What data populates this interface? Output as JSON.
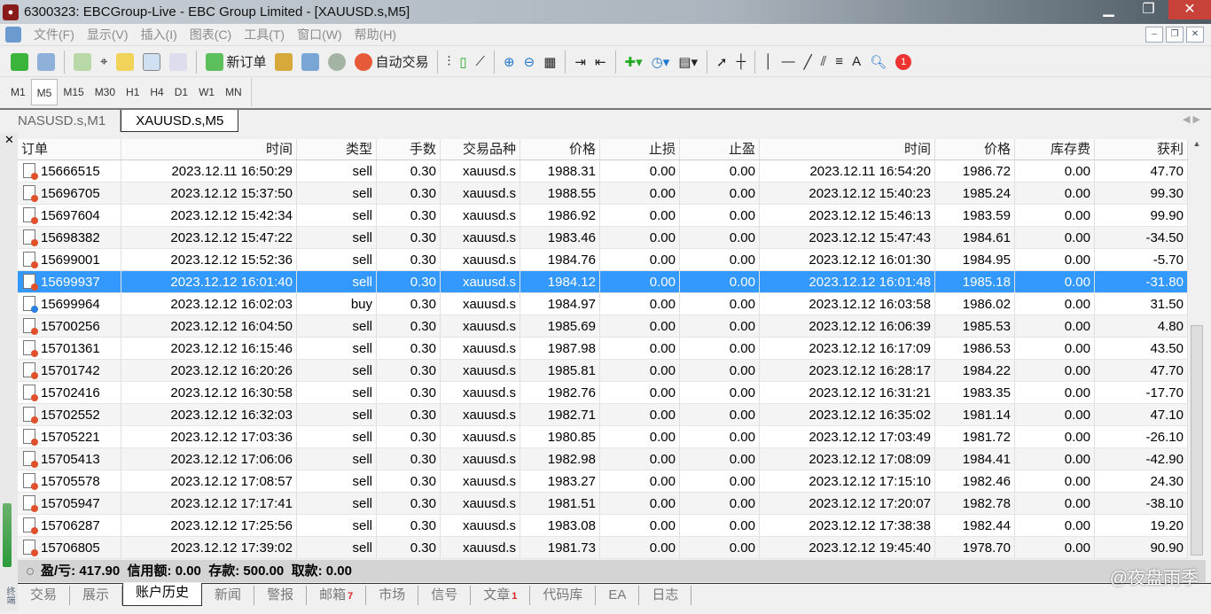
{
  "window": {
    "title": "6300323: EBCGroup-Live - EBC Group Limited - [XAUUSD.s,M5]"
  },
  "menu": [
    "文件(F)",
    "显示(V)",
    "插入(I)",
    "图表(C)",
    "工具(T)",
    "窗口(W)",
    "帮助(H)"
  ],
  "toolbar": {
    "new_order": "新订单",
    "auto_trading": "自动交易",
    "notification_count": "1"
  },
  "periods": [
    "M1",
    "M5",
    "M15",
    "M30",
    "H1",
    "H4",
    "D1",
    "W1",
    "MN"
  ],
  "selected_period": "M5",
  "chart_tabs": [
    "NASUSD.s,M1",
    "XAUUSD.s,M5"
  ],
  "table": {
    "columns": [
      "订单",
      "时间",
      "类型",
      "手数",
      "交易品种",
      "价格",
      "止损",
      "止盈",
      "时间",
      "价格",
      "库存费",
      "获利"
    ],
    "rows": [
      [
        "15666515",
        "2023.12.11 16:50:29",
        "sell",
        "0.30",
        "xauusd.s",
        "1988.31",
        "0.00",
        "0.00",
        "2023.12.11 16:54:20",
        "1986.72",
        "0.00",
        "47.70"
      ],
      [
        "15696705",
        "2023.12.12 15:37:50",
        "sell",
        "0.30",
        "xauusd.s",
        "1988.55",
        "0.00",
        "0.00",
        "2023.12.12 15:40:23",
        "1985.24",
        "0.00",
        "99.30"
      ],
      [
        "15697604",
        "2023.12.12 15:42:34",
        "sell",
        "0.30",
        "xauusd.s",
        "1986.92",
        "0.00",
        "0.00",
        "2023.12.12 15:46:13",
        "1983.59",
        "0.00",
        "99.90"
      ],
      [
        "15698382",
        "2023.12.12 15:47:22",
        "sell",
        "0.30",
        "xauusd.s",
        "1983.46",
        "0.00",
        "0.00",
        "2023.12.12 15:47:43",
        "1984.61",
        "0.00",
        "-34.50"
      ],
      [
        "15699001",
        "2023.12.12 15:52:36",
        "sell",
        "0.30",
        "xauusd.s",
        "1984.76",
        "0.00",
        "0.00",
        "2023.12.12 16:01:30",
        "1984.95",
        "0.00",
        "-5.70"
      ],
      [
        "15699937",
        "2023.12.12 16:01:40",
        "sell",
        "0.30",
        "xauusd.s",
        "1984.12",
        "0.00",
        "0.00",
        "2023.12.12 16:01:48",
        "1985.18",
        "0.00",
        "-31.80"
      ],
      [
        "15699964",
        "2023.12.12 16:02:03",
        "buy",
        "0.30",
        "xauusd.s",
        "1984.97",
        "0.00",
        "0.00",
        "2023.12.12 16:03:58",
        "1986.02",
        "0.00",
        "31.50"
      ],
      [
        "15700256",
        "2023.12.12 16:04:50",
        "sell",
        "0.30",
        "xauusd.s",
        "1985.69",
        "0.00",
        "0.00",
        "2023.12.12 16:06:39",
        "1985.53",
        "0.00",
        "4.80"
      ],
      [
        "15701361",
        "2023.12.12 16:15:46",
        "sell",
        "0.30",
        "xauusd.s",
        "1987.98",
        "0.00",
        "0.00",
        "2023.12.12 16:17:09",
        "1986.53",
        "0.00",
        "43.50"
      ],
      [
        "15701742",
        "2023.12.12 16:20:26",
        "sell",
        "0.30",
        "xauusd.s",
        "1985.81",
        "0.00",
        "0.00",
        "2023.12.12 16:28:17",
        "1984.22",
        "0.00",
        "47.70"
      ],
      [
        "15702416",
        "2023.12.12 16:30:58",
        "sell",
        "0.30",
        "xauusd.s",
        "1982.76",
        "0.00",
        "0.00",
        "2023.12.12 16:31:21",
        "1983.35",
        "0.00",
        "-17.70"
      ],
      [
        "15702552",
        "2023.12.12 16:32:03",
        "sell",
        "0.30",
        "xauusd.s",
        "1982.71",
        "0.00",
        "0.00",
        "2023.12.12 16:35:02",
        "1981.14",
        "0.00",
        "47.10"
      ],
      [
        "15705221",
        "2023.12.12 17:03:36",
        "sell",
        "0.30",
        "xauusd.s",
        "1980.85",
        "0.00",
        "0.00",
        "2023.12.12 17:03:49",
        "1981.72",
        "0.00",
        "-26.10"
      ],
      [
        "15705413",
        "2023.12.12 17:06:06",
        "sell",
        "0.30",
        "xauusd.s",
        "1982.98",
        "0.00",
        "0.00",
        "2023.12.12 17:08:09",
        "1984.41",
        "0.00",
        "-42.90"
      ],
      [
        "15705578",
        "2023.12.12 17:08:57",
        "sell",
        "0.30",
        "xauusd.s",
        "1983.27",
        "0.00",
        "0.00",
        "2023.12.12 17:15:10",
        "1982.46",
        "0.00",
        "24.30"
      ],
      [
        "15705947",
        "2023.12.12 17:17:41",
        "sell",
        "0.30",
        "xauusd.s",
        "1981.51",
        "0.00",
        "0.00",
        "2023.12.12 17:20:07",
        "1982.78",
        "0.00",
        "-38.10"
      ],
      [
        "15706287",
        "2023.12.12 17:25:56",
        "sell",
        "0.30",
        "xauusd.s",
        "1983.08",
        "0.00",
        "0.00",
        "2023.12.12 17:38:38",
        "1982.44",
        "0.00",
        "19.20"
      ],
      [
        "15706805",
        "2023.12.12 17:39:02",
        "sell",
        "0.30",
        "xauusd.s",
        "1981.73",
        "0.00",
        "0.00",
        "2023.12.12 19:45:40",
        "1978.70",
        "0.00",
        "90.90"
      ]
    ],
    "selected_index": 5
  },
  "summary": "盈/亏: 417.90  信用额: 0.00  存款: 500.00  取款: 0.00",
  "bottom_tabs": [
    {
      "label": "交易"
    },
    {
      "label": "展示"
    },
    {
      "label": "账户历史",
      "active": true
    },
    {
      "label": "新闻"
    },
    {
      "label": "警报"
    },
    {
      "label": "邮箱",
      "badge": "7"
    },
    {
      "label": "市场"
    },
    {
      "label": "信号"
    },
    {
      "label": "文章",
      "badge": "1"
    },
    {
      "label": "代码库"
    },
    {
      "label": "EA"
    },
    {
      "label": "日志"
    }
  ],
  "side_label": "终端",
  "watermark": "@夜盘雨季",
  "colors": {
    "sell_dot": "#e0502a",
    "buy_dot": "#2a7fe0",
    "selected_row": "#3399ff"
  }
}
